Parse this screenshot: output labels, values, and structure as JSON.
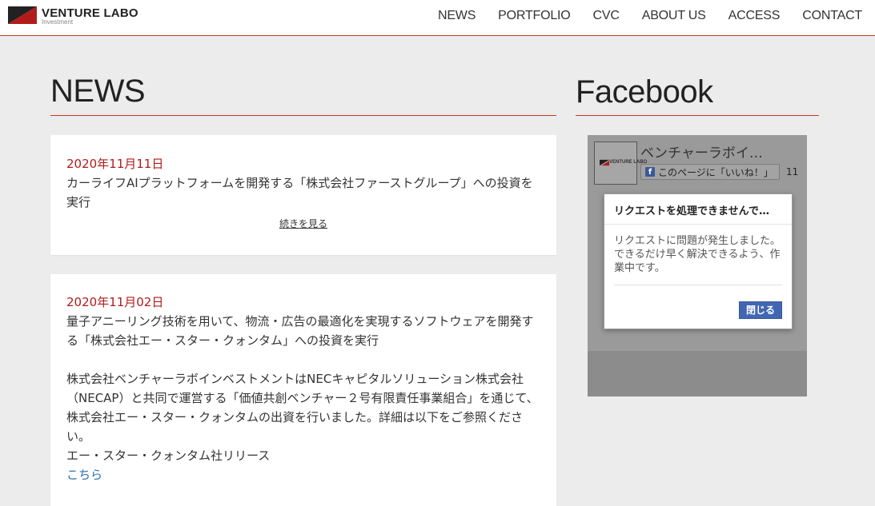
{
  "header": {
    "logo_title": "VENTURE LABO",
    "logo_sub": "Investment",
    "nav": [
      "NEWS",
      "PORTFOLIO",
      "CVC",
      "ABOUT US",
      "ACCESS",
      "CONTACT"
    ]
  },
  "news": {
    "heading": "NEWS",
    "items": [
      {
        "date": "2020年11月11日",
        "title": "カーライフAIプラットフォームを開発する「株式会社ファーストグループ」への投資を実行",
        "more": "続きを見る"
      },
      {
        "date": "2020年11月02日",
        "title": "量子アニーリング技術を用いて、物流・広告の最適化を実現するソフトウェアを開発する「株式会社エー・スター・クォンタム」への投資を実行",
        "body": "株式会社ベンチャーラボインベストメントはNECキャピタルソリューション株式会社（NECAP）と共同で運営する「価値共創ベンチャー２号有限責任事業組合」を通じて、株式会社エー・スター・クォンタムの出資を行いました。詳細は以下をご参照ください。",
        "release": "エー・スター・クォンタム社リリース",
        "link": "こちら"
      }
    ]
  },
  "facebook": {
    "heading": "Facebook",
    "page_name": "ベンチャーラボイ…",
    "thumb_text": "VENTURE LABO",
    "like_label": "このページに「いいね！」",
    "like_count": "11",
    "dialog": {
      "title": "リクエストを処理できませんで…",
      "body": "リクエストに問題が発生しました。できるだけ早く解決できるよう、作業中です。",
      "close": "閉じる"
    }
  },
  "colors": {
    "accent": "#c0392b",
    "date_red": "#b31b1b",
    "link_blue": "#2a6fb5",
    "fb_blue": "#4267b2"
  }
}
